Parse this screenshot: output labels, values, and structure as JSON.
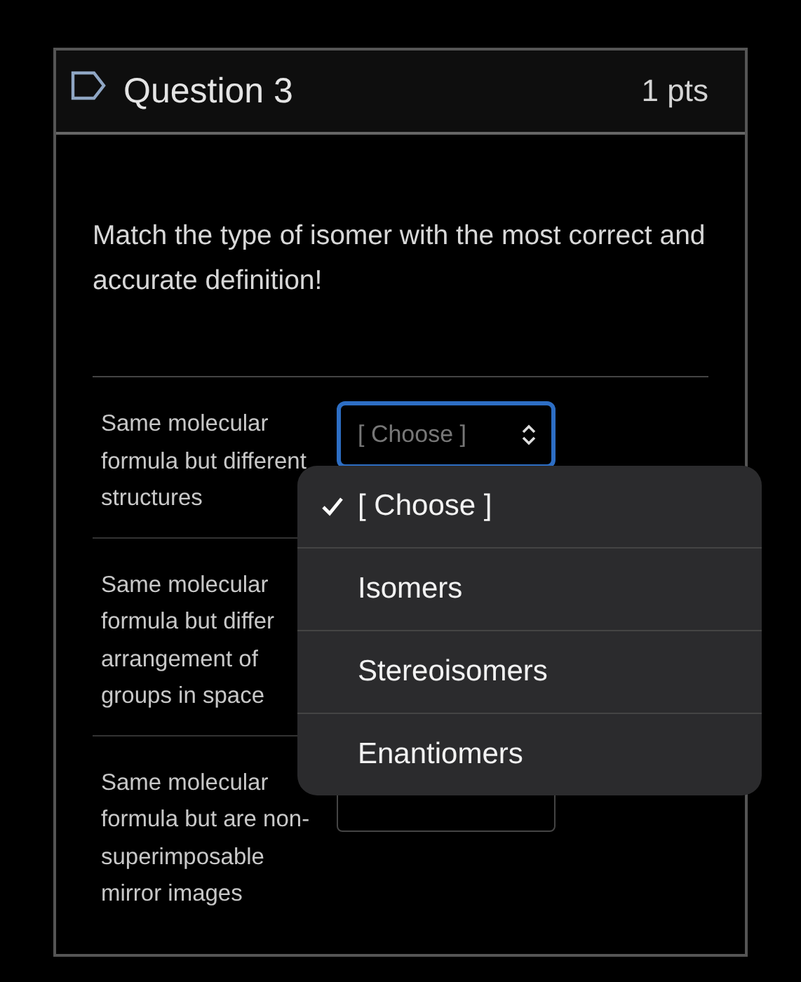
{
  "question": {
    "title": "Question 3",
    "points": "1 pts"
  },
  "prompt": "Match the type of isomer with the most correct and accurate definition!",
  "rows": [
    {
      "text": "Same molecular\nformula but different\nstructures",
      "select": {
        "value": "[ Choose ]",
        "focused": true
      }
    },
    {
      "text": "Same molecular\nformula but differ\narrangement of\ngroups in space"
    },
    {
      "text": "Same molecular\nformula but are non-\nsuperimposable\nmirror images",
      "select": {
        "focused": false
      }
    }
  ],
  "menu": {
    "options": [
      {
        "label": "[ Choose ]",
        "selected": true
      },
      {
        "label": "Isomers",
        "selected": false
      },
      {
        "label": "Stereoisomers",
        "selected": false
      },
      {
        "label": "Enantiomers",
        "selected": false
      }
    ]
  }
}
